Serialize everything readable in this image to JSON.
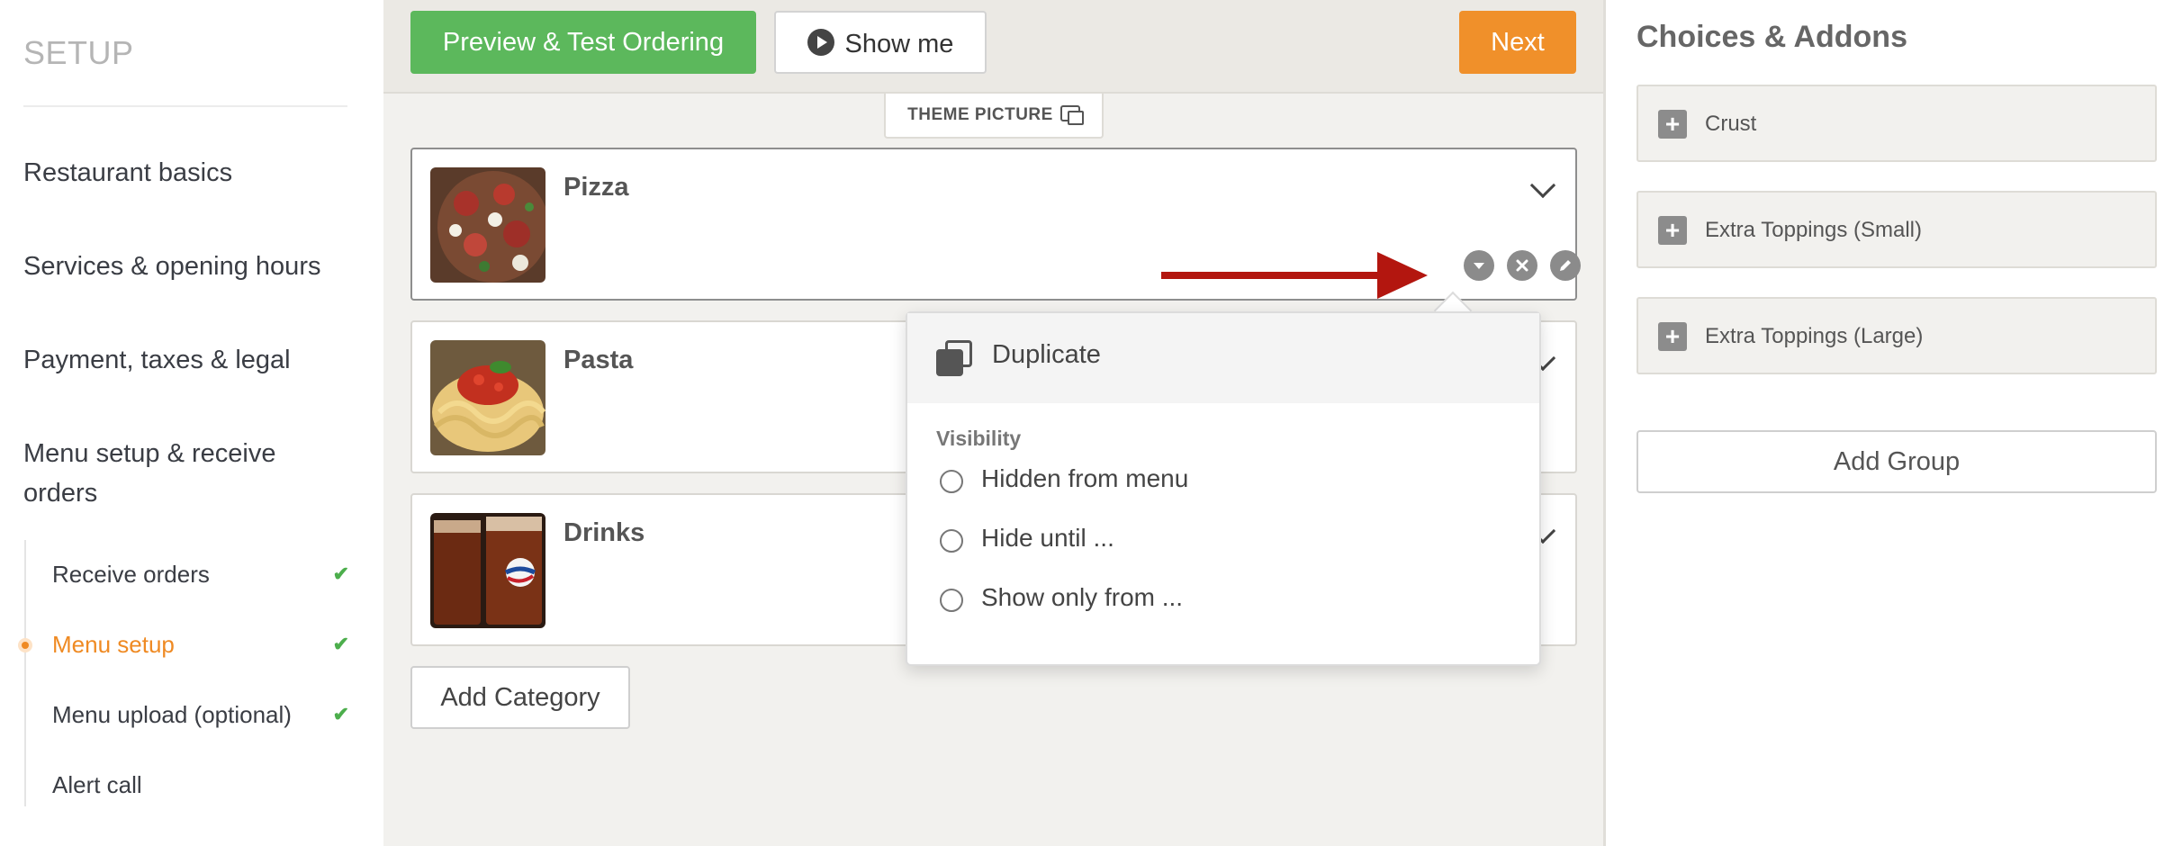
{
  "sidebar": {
    "title": "SETUP",
    "items": [
      {
        "label": "Restaurant basics"
      },
      {
        "label": "Services & opening hours"
      },
      {
        "label": "Payment, taxes & legal"
      },
      {
        "label": "Menu setup & receive orders"
      }
    ],
    "sub_items": [
      {
        "label": "Receive orders",
        "checked": true,
        "active": false
      },
      {
        "label": "Menu setup",
        "checked": true,
        "active": true
      },
      {
        "label": "Menu upload (optional)",
        "checked": true,
        "active": false
      },
      {
        "label": "Alert call",
        "checked": false,
        "active": false
      }
    ]
  },
  "toolbar": {
    "preview_label": "Preview & Test Ordering",
    "show_me_label": "Show me",
    "next_label": "Next"
  },
  "theme_tab": {
    "label": "THEME PICTURE"
  },
  "categories": [
    {
      "name": "Pizza"
    },
    {
      "name": "Pasta"
    },
    {
      "name": "Drinks"
    }
  ],
  "add_category_label": "Add Category",
  "popover": {
    "duplicate_label": "Duplicate",
    "visibility_heading": "Visibility",
    "options": [
      {
        "label": "Hidden from menu"
      },
      {
        "label": "Hide until ..."
      },
      {
        "label": "Show only from ..."
      }
    ]
  },
  "right_panel": {
    "title": "Choices & Addons",
    "groups": [
      {
        "label": "Crust"
      },
      {
        "label": "Extra Toppings (Small)"
      },
      {
        "label": "Extra Toppings (Large)"
      }
    ],
    "add_group_label": "Add Group"
  },
  "colors": {
    "accent_orange": "#ef8a23",
    "green": "#5cb85c",
    "annotation_red": "#b3160f"
  }
}
